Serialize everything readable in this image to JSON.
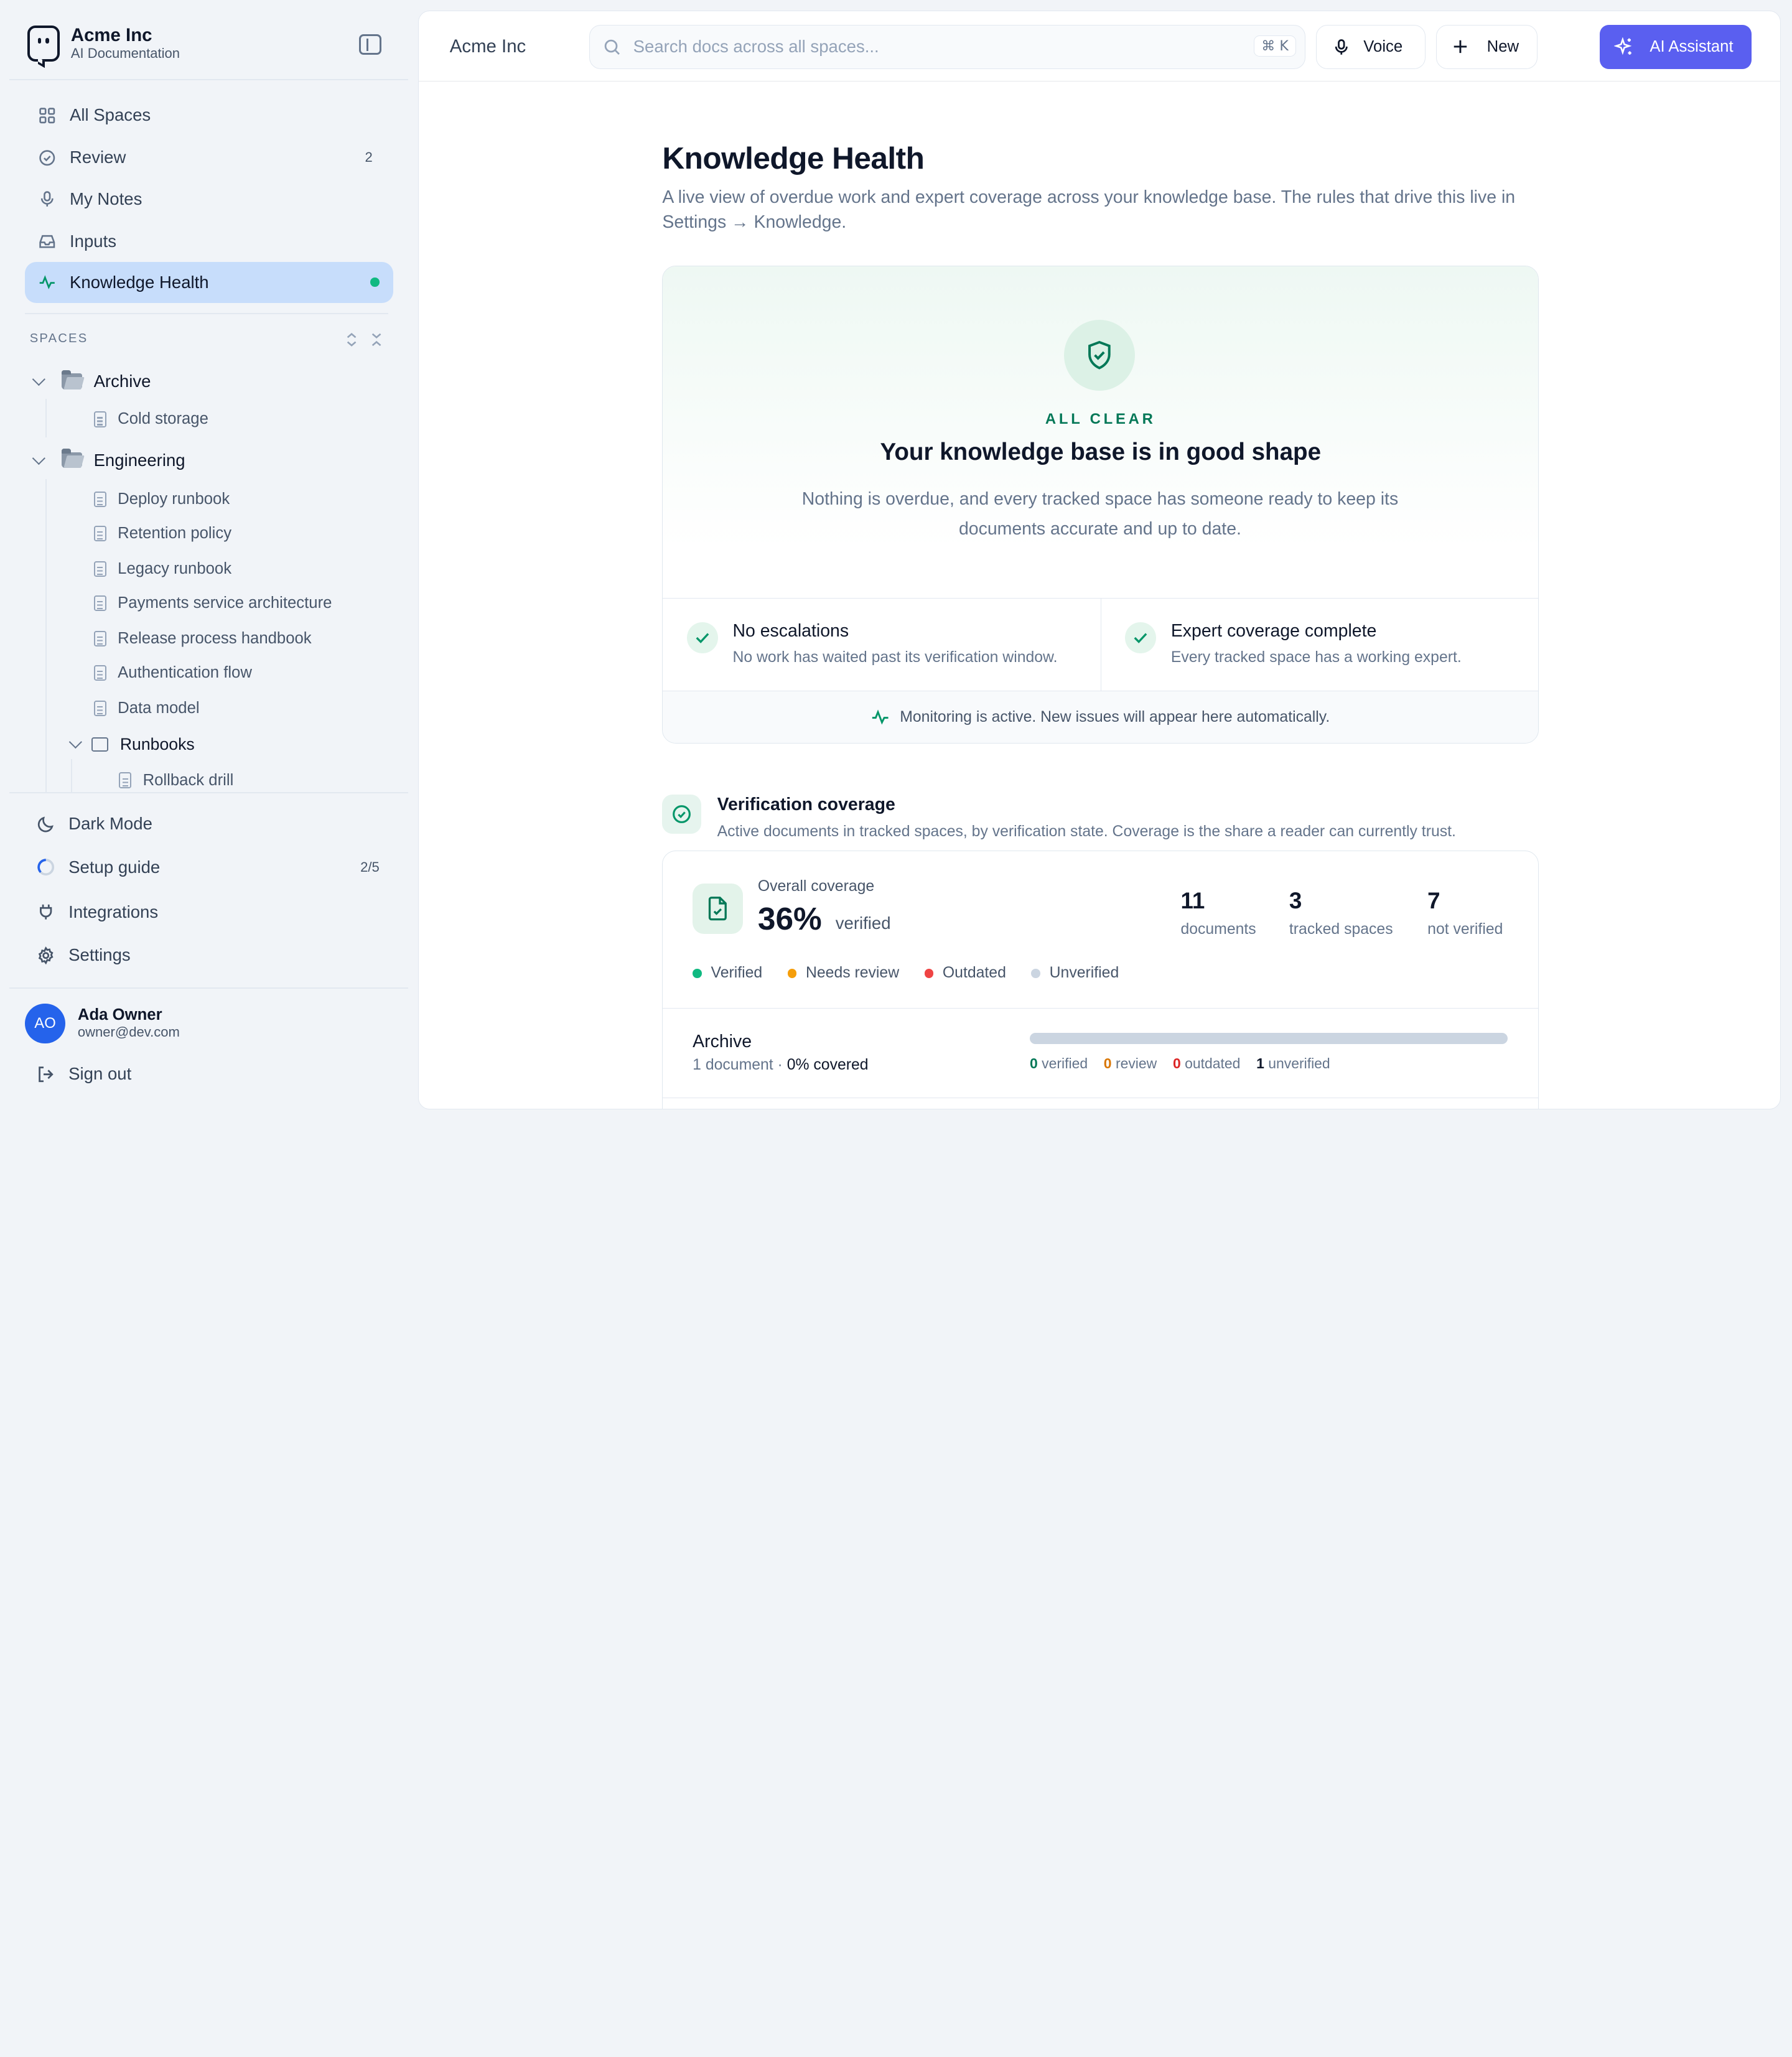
{
  "brand": {
    "name": "Acme Inc",
    "subtitle": "AI Documentation"
  },
  "nav": [
    {
      "label": "All Spaces",
      "icon": "grid-icon"
    },
    {
      "label": "Review",
      "icon": "check-circle-icon",
      "badge": "2"
    },
    {
      "label": "My Notes",
      "icon": "mic-icon"
    },
    {
      "label": "Inputs",
      "icon": "inbox-icon"
    },
    {
      "label": "Knowledge Health",
      "icon": "activity-icon",
      "active": true
    }
  ],
  "spaces": {
    "header": "SPACES",
    "tree": {
      "archive": {
        "label": "Archive",
        "children": [
          "Cold storage"
        ]
      },
      "engineering": {
        "label": "Engineering",
        "children": [
          "Deploy runbook",
          "Retention policy",
          "Legacy runbook",
          "Payments service architecture",
          "Release process handbook",
          "Authentication flow",
          "Data model"
        ],
        "subfolder": {
          "label": "Runbooks",
          "children": [
            "Rollback drill"
          ]
        }
      }
    }
  },
  "footer": {
    "dark_mode": "Dark Mode",
    "setup_guide": "Setup guide",
    "setup_progress": "2/5",
    "integrations": "Integrations",
    "settings": "Settings",
    "sign_out": "Sign out"
  },
  "user": {
    "initials": "AO",
    "name": "Ada Owner",
    "email": "owner@dev.com"
  },
  "topbar": {
    "title": "Acme Inc",
    "search_placeholder": "Search docs across all spaces...",
    "shortcut": "⌘ K",
    "voice": "Voice",
    "new": "New",
    "ai_assistant": "AI Assistant"
  },
  "page": {
    "title": "Knowledge Health",
    "lead": "A live view of overdue work and expert coverage across your knowledge base. The rules that drive this live in Settings → Knowledge."
  },
  "health": {
    "status": "ALL CLEAR",
    "headline": "Your knowledge base is in good shape",
    "description": "Nothing is overdue, and every tracked space has someone ready to keep its documents accurate and up to date.",
    "checks": [
      {
        "title": "No escalations",
        "subtitle": "No work has waited past its verification window."
      },
      {
        "title": "Expert coverage complete",
        "subtitle": "Every tracked space has a working expert."
      }
    ],
    "monitoring": "Monitoring is active. New issues will appear here automatically."
  },
  "coverage": {
    "title": "Verification coverage",
    "subtitle": "Active documents in tracked spaces, by verification state. Coverage is the share a reader can currently trust.",
    "overall_label": "Overall coverage",
    "overall_pct": "36%",
    "overall_suffix": "verified",
    "stats": [
      {
        "value": "11",
        "label": "documents"
      },
      {
        "value": "3",
        "label": "tracked spaces"
      },
      {
        "value": "7",
        "label": "not verified"
      }
    ],
    "legend": [
      {
        "label": "Verified",
        "color": "#10b981"
      },
      {
        "label": "Needs review",
        "color": "#f59e0b"
      },
      {
        "label": "Outdated",
        "color": "#ef4444"
      },
      {
        "label": "Unverified",
        "color": "#cbd5e1"
      }
    ],
    "rows": [
      {
        "name": "Archive",
        "doc_count": "1 document",
        "covered": "0% covered",
        "verified_fraction": 0,
        "counts": {
          "verified": "0",
          "verified_label": "verified",
          "review": "0",
          "review_label": "review",
          "outdated": "0",
          "outdated_label": "outdated",
          "unverified": "1",
          "unverified_label": "unverified"
        }
      }
    ]
  },
  "colors": {
    "accent": "#5a5ff0",
    "active_nav": "#c7ddfb",
    "success": "#10b981"
  }
}
